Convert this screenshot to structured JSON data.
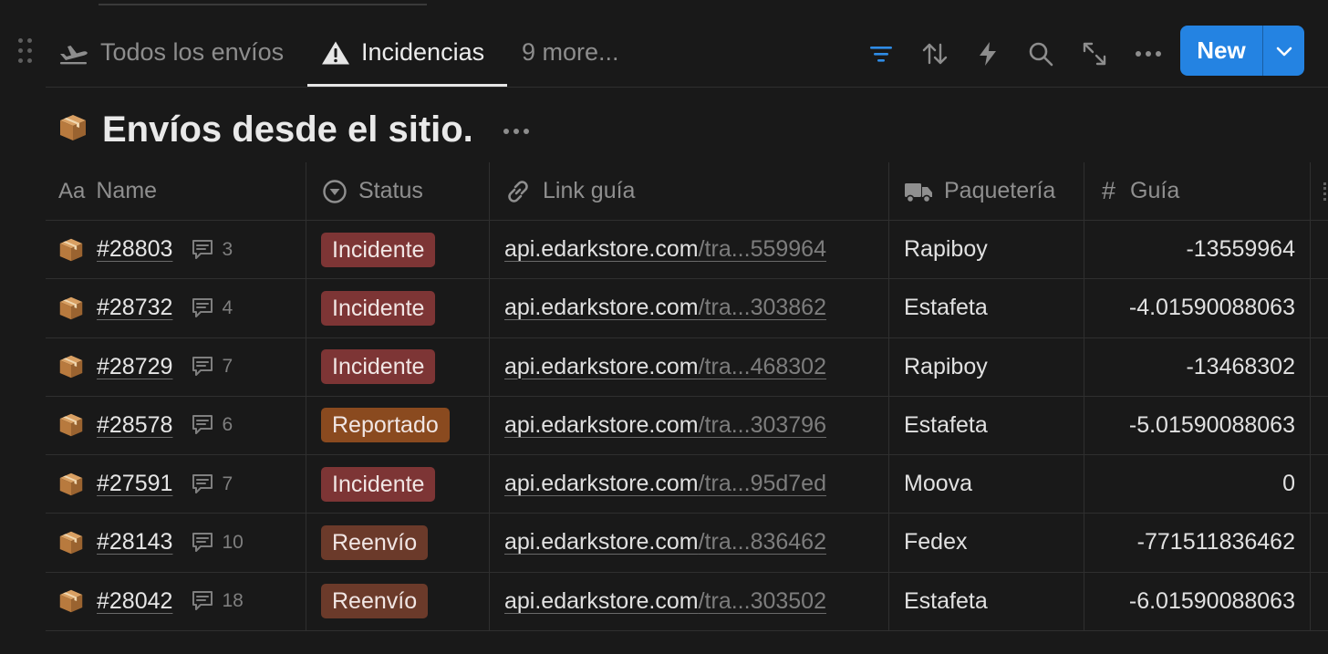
{
  "tabs": [
    {
      "label": "Todos los envíos",
      "icon": "airplane-departure-icon",
      "active": false
    },
    {
      "label": "Incidencias",
      "icon": "warning-triangle-icon",
      "active": true
    },
    {
      "label": "9 more...",
      "icon": "",
      "active": false
    }
  ],
  "toolbar": {
    "icons": [
      "filter-icon",
      "sort-icon",
      "lightning-icon",
      "search-icon",
      "expand-icon",
      "more-icon"
    ],
    "new_label": "New",
    "accent_color": "#2483e2",
    "filter_color": "#2f8ce6"
  },
  "database": {
    "icon": "package-icon",
    "title": "Envíos desde el sitio."
  },
  "columns": {
    "name": {
      "label": "Name",
      "type_label": "Aa"
    },
    "status": {
      "label": "Status"
    },
    "link": {
      "label": "Link guía"
    },
    "paqueteria": {
      "label": "Paquetería"
    },
    "guia": {
      "label": "Guía",
      "type_label": "#"
    }
  },
  "status_colors": {
    "Incidente": "#7d3535",
    "Reportado": "#8a4a1f",
    "Reenvío": "#6b3a2a"
  },
  "rows": [
    {
      "name": "#28803",
      "comments": "3",
      "status": "Incidente",
      "link_host": "api.edarkstore.com",
      "link_rest": "/tra...559964",
      "paqueteria": "Rapiboy",
      "guia": "-13559964"
    },
    {
      "name": "#28732",
      "comments": "4",
      "status": "Incidente",
      "link_host": "api.edarkstore.com",
      "link_rest": "/tra...303862",
      "paqueteria": "Estafeta",
      "guia": "-4.01590088063"
    },
    {
      "name": "#28729",
      "comments": "7",
      "status": "Incidente",
      "link_host": "api.edarkstore.com",
      "link_rest": "/tra...468302",
      "paqueteria": "Rapiboy",
      "guia": "-13468302"
    },
    {
      "name": "#28578",
      "comments": "6",
      "status": "Reportado",
      "link_host": "api.edarkstore.com",
      "link_rest": "/tra...303796",
      "paqueteria": "Estafeta",
      "guia": "-5.01590088063"
    },
    {
      "name": "#27591",
      "comments": "7",
      "status": "Incidente",
      "link_host": "api.edarkstore.com",
      "link_rest": "/tra...95d7ed",
      "paqueteria": "Moova",
      "guia": "0"
    },
    {
      "name": "#28143",
      "comments": "10",
      "status": "Reenvío",
      "link_host": "api.edarkstore.com",
      "link_rest": "/tra...836462",
      "paqueteria": "Fedex",
      "guia": "-771511836462"
    },
    {
      "name": "#28042",
      "comments": "18",
      "status": "Reenvío",
      "link_host": "api.edarkstore.com",
      "link_rest": "/tra...303502",
      "paqueteria": "Estafeta",
      "guia": "-6.01590088063"
    }
  ]
}
